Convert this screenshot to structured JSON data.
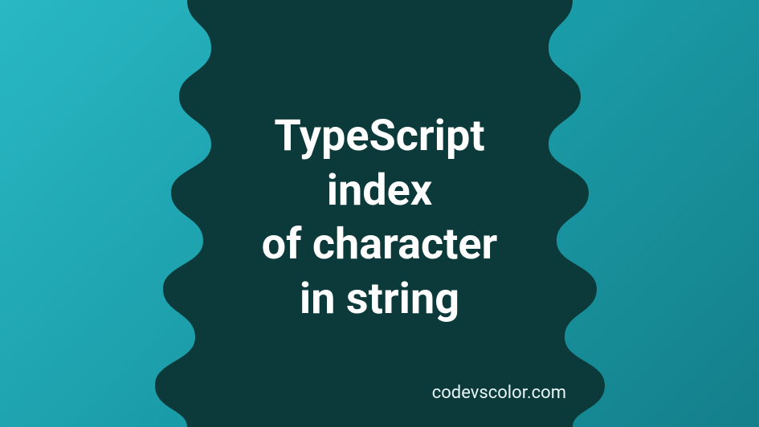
{
  "title_line1": "TypeScript",
  "title_line2": "index",
  "title_line3": "of character",
  "title_line4": "in string",
  "attribution": "codevscolor.com",
  "colors": {
    "blob": "#0c3a3a",
    "text": "#ffffff",
    "bg_light": "#29b8c4",
    "bg_dark": "#147f8a"
  }
}
